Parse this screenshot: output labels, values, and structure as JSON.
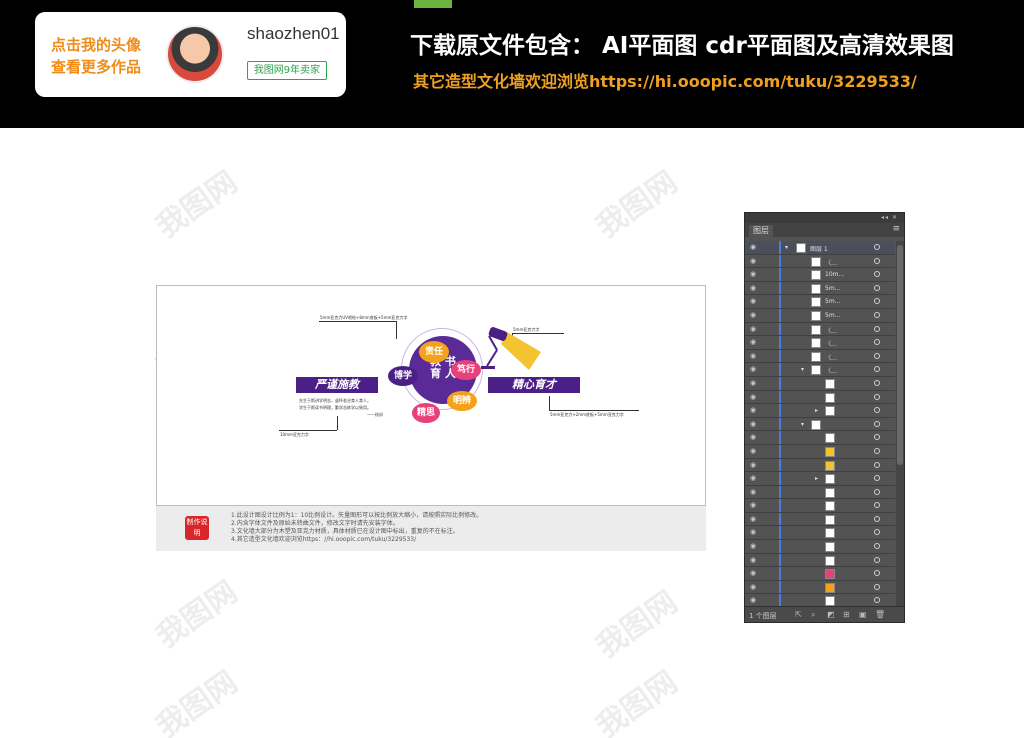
{
  "banner": {
    "author_cta_line1": "点击我的头像",
    "author_cta_line2": "查看更多作品",
    "author_name": "shaozhen01",
    "seller_badge": "我图网9年卖家",
    "headline": "下载原文件包含：  AI平面图   cdr平面图及高清效果图",
    "subline": "其它造型文化墙欢迎浏览https://hi.ooopic.com/tuku/3229533/"
  },
  "watermark": "我图网",
  "design": {
    "left_ribbon": "严谨施教",
    "right_ribbon": "精心育才",
    "center_text_line1": "教 书",
    "center_text_line2": "育 人",
    "blobs": [
      "责任",
      "笃行",
      "博学",
      "精思",
      "明辨"
    ],
    "callout_top": "5mm亚克力UV喷绘+8mm底板+5mm亚克力字",
    "callout_right_top": "5mm亚克力字",
    "callout_right_bottom": "5mm亚克力+2mm底板+5mm亚克力字",
    "callout_left_bottom": "10mm亚克力字",
    "body_line1": "先生于斯讲学明志，虚怀若谷育人育人。",
    "body_line2": "学生于斯读书明理，勤学苦练学以致用。",
    "body_sign": "——校训"
  },
  "notes": {
    "badge": "制作说明",
    "items": [
      "1.此设计图设计比例为1：10比例设计。矢量图形可以按比例放大缩小，请按照实际比例修改。",
      "2.内含字体文件及原始未转曲文件，修改文字时请先安装字体。",
      "3.文化墙大部分为木塑及亚克力材质，具体材质已在设计图中标出，重复的不在标注。",
      "4.其它造型文化墙欢迎浏览https：//hi.ooopic.com/tuku/3229533/"
    ]
  },
  "layers_panel": {
    "tab_label": "图层",
    "top_layer_name": "图层 1",
    "sublayers": [
      "〈...",
      "10m...",
      "5m...",
      "5m...",
      "5m...",
      "〈...",
      "〈...",
      "〈...",
      "〈..."
    ],
    "layer_count": "1 个图层"
  }
}
